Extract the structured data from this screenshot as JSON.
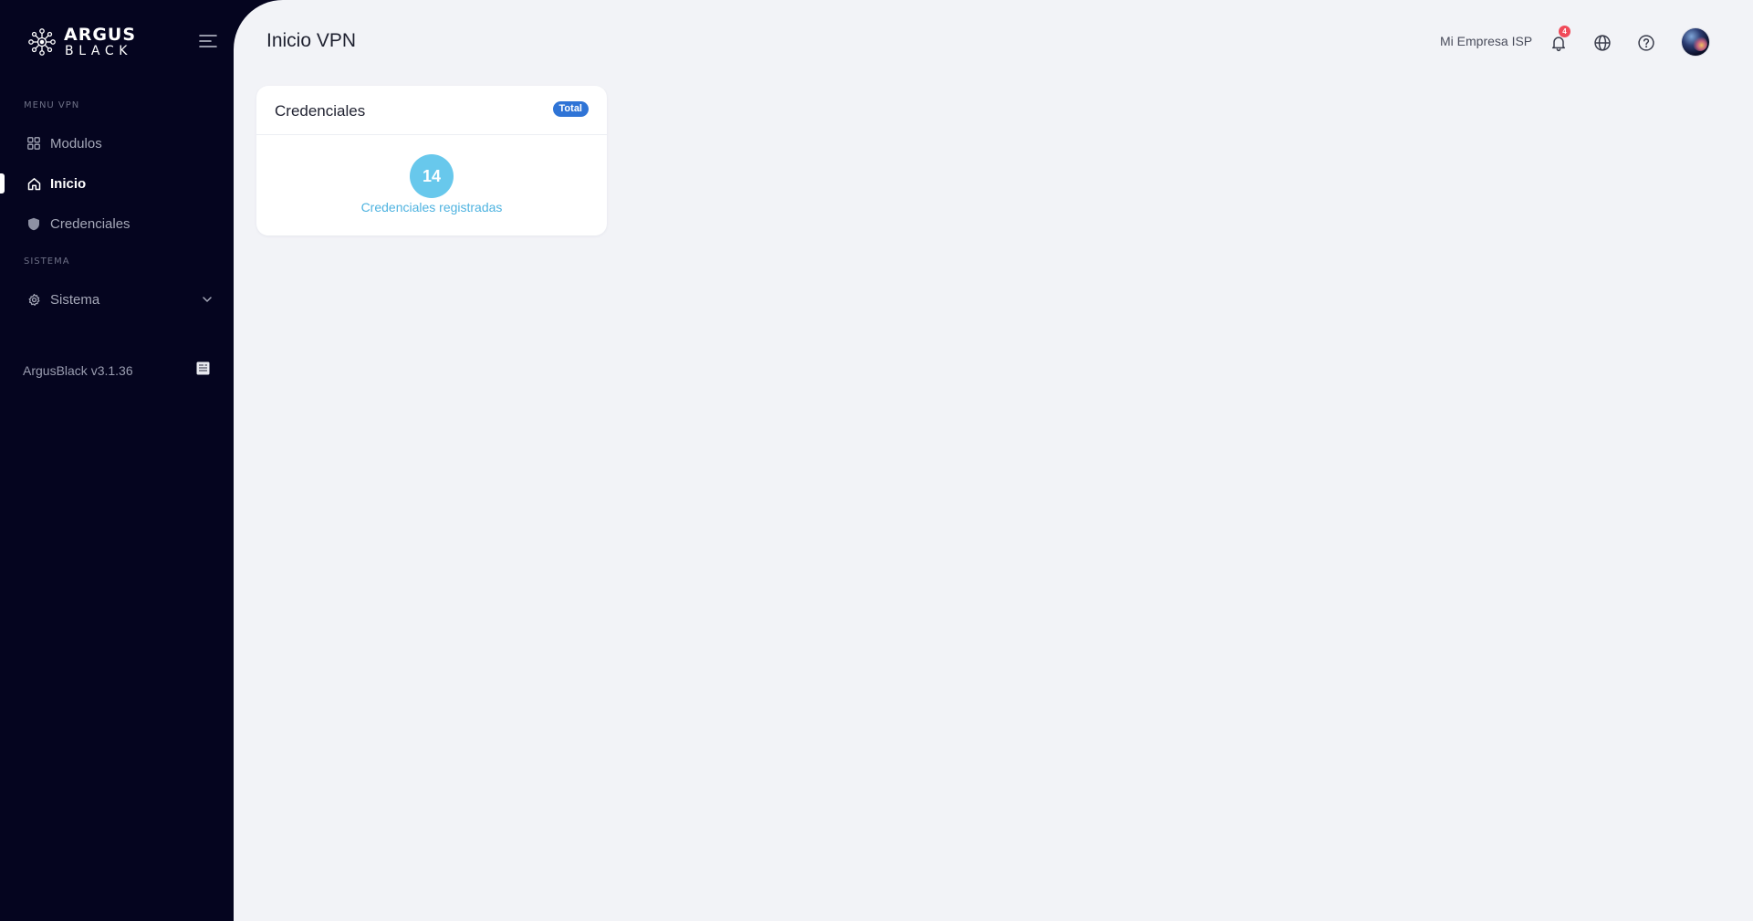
{
  "brand": {
    "top": "ARGUS",
    "bottom": "BLACK"
  },
  "sidebar": {
    "sections": [
      {
        "label": "MENU VPN"
      },
      {
        "label": "SISTEMA"
      }
    ],
    "items": [
      {
        "label": "Modulos",
        "icon": "grid-icon"
      },
      {
        "label": "Inicio",
        "icon": "home-icon",
        "active": true
      },
      {
        "label": "Credenciales",
        "icon": "shield-icon"
      },
      {
        "label": "Sistema",
        "icon": "gear-icon",
        "expandable": true
      }
    ],
    "version": "ArgusBlack v3.1.36"
  },
  "header": {
    "title": "Inicio VPN",
    "company": "Mi Empresa ISP",
    "notifications_count": "4"
  },
  "card": {
    "title": "Credenciales",
    "badge": "Total",
    "count": "14",
    "count_label": "Credenciales registradas"
  },
  "colors": {
    "sidebar_bg": "#05051f",
    "main_bg": "#f2f3f7",
    "badge_blue": "#2f74d6",
    "count_circle": "#68c8ec",
    "count_text": "#4fb3e0",
    "notification_red": "#f04b5a"
  }
}
